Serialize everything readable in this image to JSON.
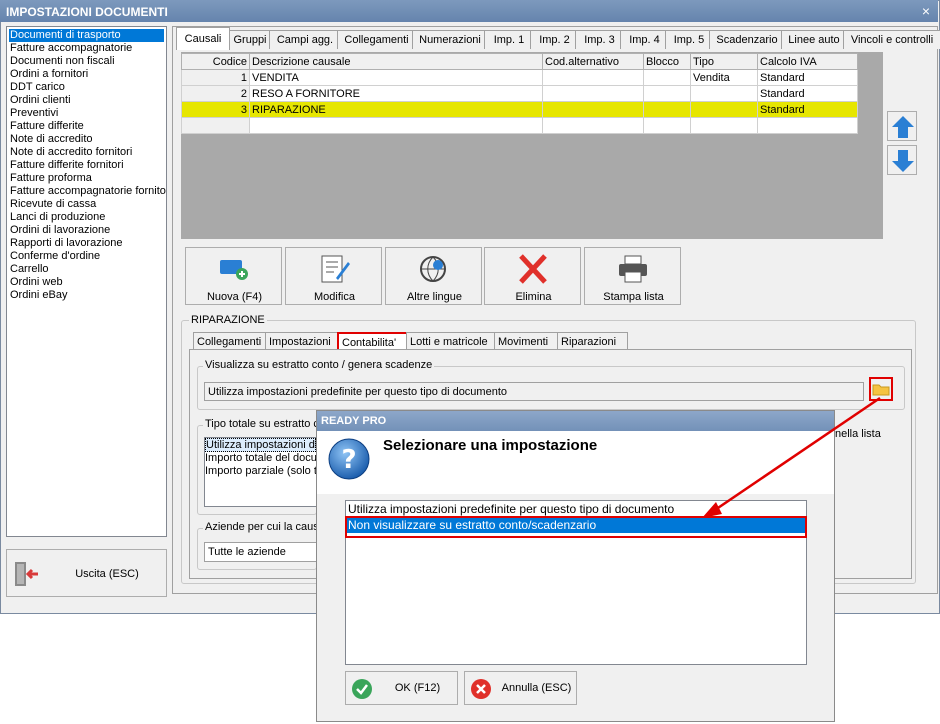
{
  "window": {
    "title": "IMPOSTAZIONI DOCUMENTI",
    "close_icon": "×"
  },
  "doc_types": [
    "Documenti di trasporto",
    "Fatture accompagnatorie",
    "Documenti non fiscali",
    "Ordini a fornitori",
    "DDT carico",
    "Ordini clienti",
    "Preventivi",
    "Fatture differite",
    "Note di accredito",
    "Note di accredito fornitori",
    "Fatture differite fornitori",
    "Fatture proforma",
    "Fatture accompagnatorie fornito",
    "Ricevute di cassa",
    "Lanci di produzione",
    "Ordini di lavorazione",
    "Rapporti di lavorazione",
    "Conferme d'ordine",
    "Carrello",
    "Ordini web",
    "Ordini eBay"
  ],
  "selected_doc_type": "Documenti di trasporto",
  "exit_button": {
    "label": "Uscita (ESC)"
  },
  "tabs": [
    "Causali",
    "Gruppi",
    "Campi agg.",
    "Collegamenti",
    "Numerazioni",
    "Imp. 1",
    "Imp. 2",
    "Imp. 3",
    "Imp. 4",
    "Imp. 5",
    "Scadenzario",
    "Linee auto",
    "Vincoli e controlli"
  ],
  "active_tab": "Causali",
  "grid": {
    "headers": [
      "Codice",
      "Descrizione causale",
      "Cod.alternativo",
      "Blocco",
      "Tipo",
      "Calcolo IVA"
    ],
    "rows": [
      [
        "1",
        "VENDITA",
        "",
        "",
        "Vendita",
        "Standard"
      ],
      [
        "2",
        "RESO A FORNITORE",
        "",
        "",
        "",
        "Standard"
      ],
      [
        "3",
        "RIPARAZIONE",
        "",
        "",
        "",
        "Standard"
      ]
    ]
  },
  "toolbar": {
    "new_label": "Nuova (F4)",
    "edit_label": "Modifica",
    "lang_label": "Altre lingue",
    "delete_label": "Elimina",
    "print_label": "Stampa lista"
  },
  "section": {
    "title": "RIPARAZIONE",
    "subtabs": [
      "Collegamenti",
      "Impostazioni",
      "Contabilita'",
      "Lotti e matricole",
      "Movimenti",
      "Riparazioni"
    ],
    "active_subtab": "Contabilita'",
    "statement_group": "Visualizza su estratto conto / genera scadenze",
    "statement_value": "Utilizza impostazioni predefinite per questo tipo di documento",
    "total_group": "Tipo totale su estratto c",
    "total_options": [
      "Utilizza impostazioni di",
      "Importo totale del docu",
      "Importo parziale (solo t"
    ],
    "list_note": "nella lista",
    "companies_group": "Aziende per cui la causa",
    "companies_value": "Tutte le aziende"
  },
  "dialog": {
    "title": "READY PRO",
    "heading": "Selezionare una impostazione",
    "options": [
      "Utilizza impostazioni predefinite per questo tipo di documento",
      "Non visualizzare su estratto conto/scadenzario"
    ],
    "ok_label": "OK (F12)",
    "cancel_label": "Annulla (ESC)"
  },
  "colors": {
    "selection": "#0078d7",
    "highlight_row": "#e6e600",
    "annotation_red": "#e00000",
    "titlebar": "#7391b8"
  }
}
